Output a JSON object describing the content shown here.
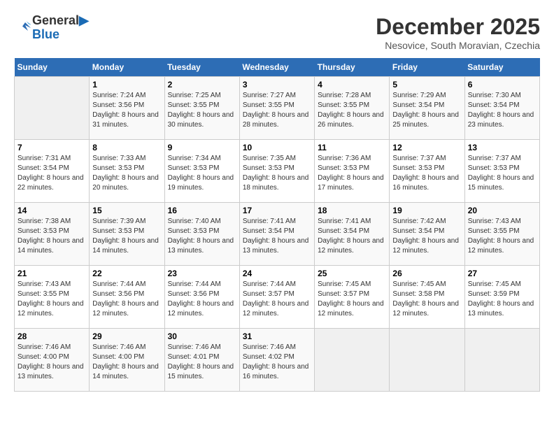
{
  "header": {
    "logo_line1": "General",
    "logo_line2": "Blue",
    "month": "December 2025",
    "location": "Nesovice, South Moravian, Czechia"
  },
  "weekdays": [
    "Sunday",
    "Monday",
    "Tuesday",
    "Wednesday",
    "Thursday",
    "Friday",
    "Saturday"
  ],
  "weeks": [
    [
      {
        "day": "",
        "empty": true
      },
      {
        "day": "1",
        "sunrise": "7:24 AM",
        "sunset": "3:56 PM",
        "daylight": "8 hours and 31 minutes."
      },
      {
        "day": "2",
        "sunrise": "7:25 AM",
        "sunset": "3:55 PM",
        "daylight": "8 hours and 30 minutes."
      },
      {
        "day": "3",
        "sunrise": "7:27 AM",
        "sunset": "3:55 PM",
        "daylight": "8 hours and 28 minutes."
      },
      {
        "day": "4",
        "sunrise": "7:28 AM",
        "sunset": "3:55 PM",
        "daylight": "8 hours and 26 minutes."
      },
      {
        "day": "5",
        "sunrise": "7:29 AM",
        "sunset": "3:54 PM",
        "daylight": "8 hours and 25 minutes."
      },
      {
        "day": "6",
        "sunrise": "7:30 AM",
        "sunset": "3:54 PM",
        "daylight": "8 hours and 23 minutes."
      }
    ],
    [
      {
        "day": "7",
        "sunrise": "7:31 AM",
        "sunset": "3:54 PM",
        "daylight": "8 hours and 22 minutes."
      },
      {
        "day": "8",
        "sunrise": "7:33 AM",
        "sunset": "3:53 PM",
        "daylight": "8 hours and 20 minutes."
      },
      {
        "day": "9",
        "sunrise": "7:34 AM",
        "sunset": "3:53 PM",
        "daylight": "8 hours and 19 minutes."
      },
      {
        "day": "10",
        "sunrise": "7:35 AM",
        "sunset": "3:53 PM",
        "daylight": "8 hours and 18 minutes."
      },
      {
        "day": "11",
        "sunrise": "7:36 AM",
        "sunset": "3:53 PM",
        "daylight": "8 hours and 17 minutes."
      },
      {
        "day": "12",
        "sunrise": "7:37 AM",
        "sunset": "3:53 PM",
        "daylight": "8 hours and 16 minutes."
      },
      {
        "day": "13",
        "sunrise": "7:37 AM",
        "sunset": "3:53 PM",
        "daylight": "8 hours and 15 minutes."
      }
    ],
    [
      {
        "day": "14",
        "sunrise": "7:38 AM",
        "sunset": "3:53 PM",
        "daylight": "8 hours and 14 minutes."
      },
      {
        "day": "15",
        "sunrise": "7:39 AM",
        "sunset": "3:53 PM",
        "daylight": "8 hours and 14 minutes."
      },
      {
        "day": "16",
        "sunrise": "7:40 AM",
        "sunset": "3:53 PM",
        "daylight": "8 hours and 13 minutes."
      },
      {
        "day": "17",
        "sunrise": "7:41 AM",
        "sunset": "3:54 PM",
        "daylight": "8 hours and 13 minutes."
      },
      {
        "day": "18",
        "sunrise": "7:41 AM",
        "sunset": "3:54 PM",
        "daylight": "8 hours and 12 minutes."
      },
      {
        "day": "19",
        "sunrise": "7:42 AM",
        "sunset": "3:54 PM",
        "daylight": "8 hours and 12 minutes."
      },
      {
        "day": "20",
        "sunrise": "7:43 AM",
        "sunset": "3:55 PM",
        "daylight": "8 hours and 12 minutes."
      }
    ],
    [
      {
        "day": "21",
        "sunrise": "7:43 AM",
        "sunset": "3:55 PM",
        "daylight": "8 hours and 12 minutes."
      },
      {
        "day": "22",
        "sunrise": "7:44 AM",
        "sunset": "3:56 PM",
        "daylight": "8 hours and 12 minutes."
      },
      {
        "day": "23",
        "sunrise": "7:44 AM",
        "sunset": "3:56 PM",
        "daylight": "8 hours and 12 minutes."
      },
      {
        "day": "24",
        "sunrise": "7:44 AM",
        "sunset": "3:57 PM",
        "daylight": "8 hours and 12 minutes."
      },
      {
        "day": "25",
        "sunrise": "7:45 AM",
        "sunset": "3:57 PM",
        "daylight": "8 hours and 12 minutes."
      },
      {
        "day": "26",
        "sunrise": "7:45 AM",
        "sunset": "3:58 PM",
        "daylight": "8 hours and 12 minutes."
      },
      {
        "day": "27",
        "sunrise": "7:45 AM",
        "sunset": "3:59 PM",
        "daylight": "8 hours and 13 minutes."
      }
    ],
    [
      {
        "day": "28",
        "sunrise": "7:46 AM",
        "sunset": "4:00 PM",
        "daylight": "8 hours and 13 minutes."
      },
      {
        "day": "29",
        "sunrise": "7:46 AM",
        "sunset": "4:00 PM",
        "daylight": "8 hours and 14 minutes."
      },
      {
        "day": "30",
        "sunrise": "7:46 AM",
        "sunset": "4:01 PM",
        "daylight": "8 hours and 15 minutes."
      },
      {
        "day": "31",
        "sunrise": "7:46 AM",
        "sunset": "4:02 PM",
        "daylight": "8 hours and 16 minutes."
      },
      {
        "day": "",
        "empty": true
      },
      {
        "day": "",
        "empty": true
      },
      {
        "day": "",
        "empty": true
      }
    ]
  ]
}
